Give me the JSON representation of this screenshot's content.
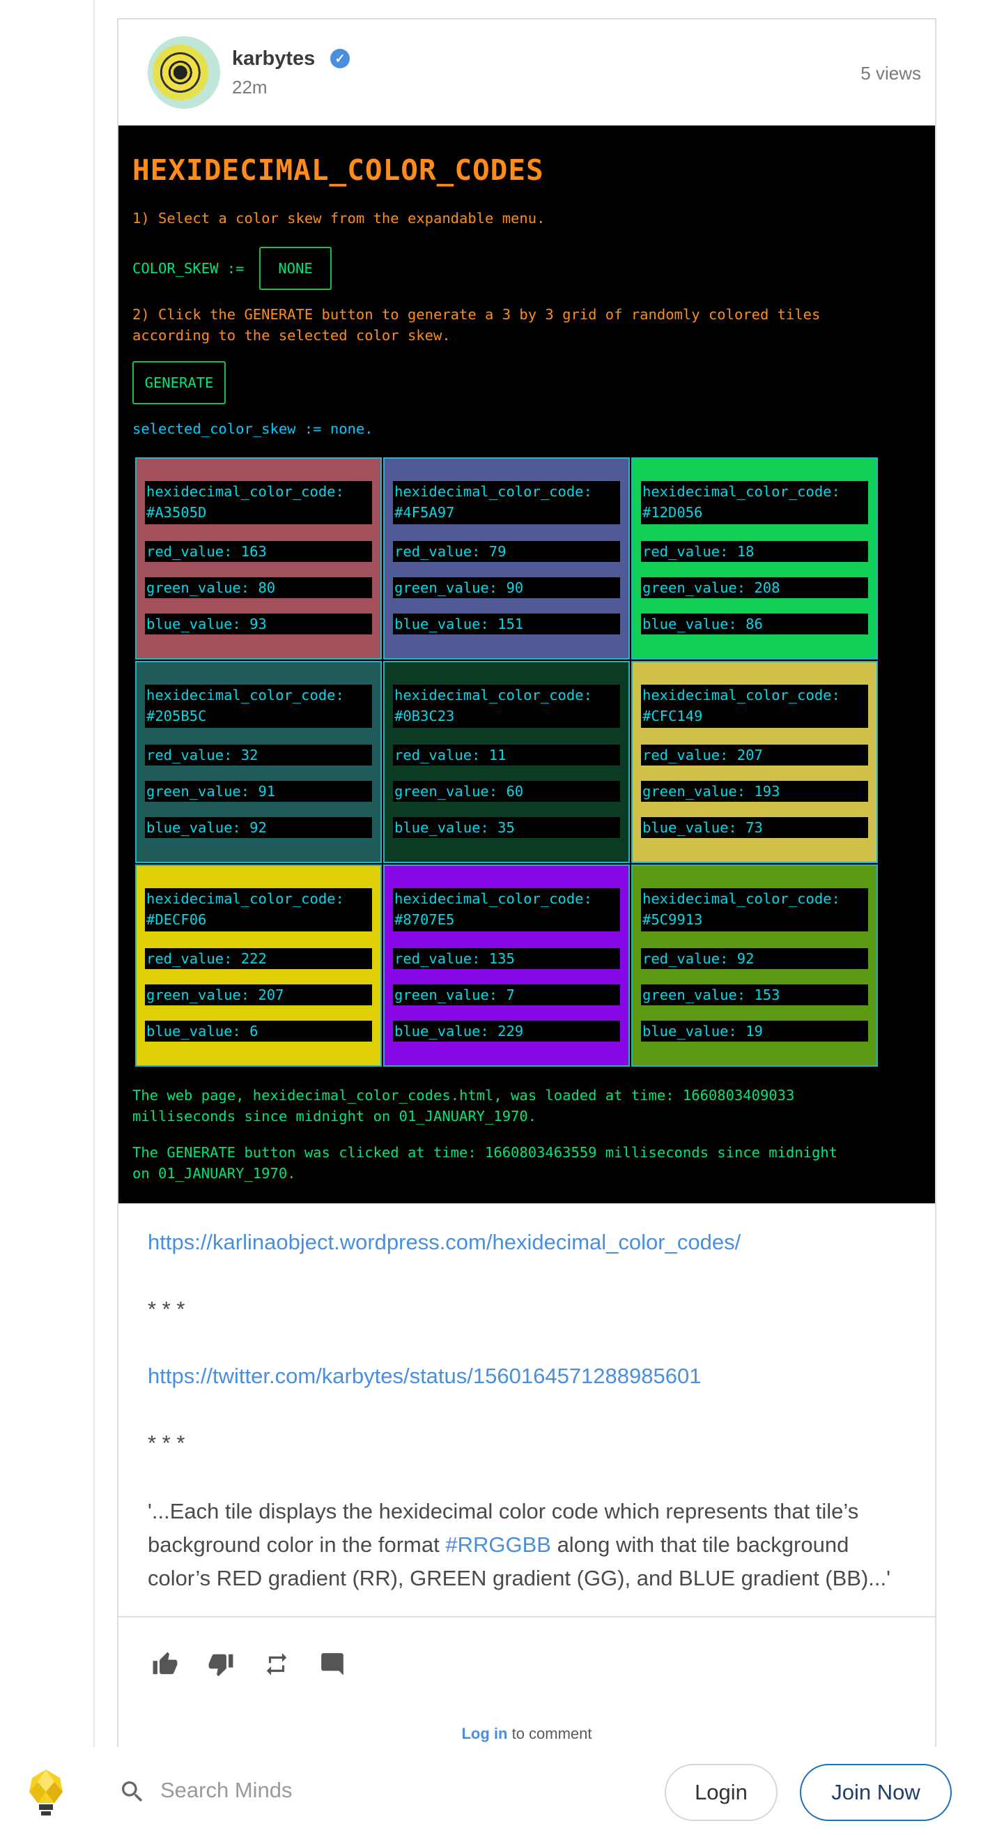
{
  "post": {
    "username": "karbytes",
    "verified_glyph": "✓",
    "time_ago": "22m",
    "views": "5 views"
  },
  "app": {
    "title": "HEXIDECIMAL_COLOR_CODES",
    "step1": "1) Select a color skew from the expandable menu.",
    "skew_label": "COLOR_SKEW :=",
    "skew_value": "NONE",
    "step2_line1": "2) Click the GENERATE button to generate a 3 by 3 grid of randomly colored tiles",
    "step2_line2": "according to the selected color skew.",
    "generate_label": "GENERATE",
    "selected_text": "selected_color_skew := none.",
    "tiles": [
      {
        "bg": "#A3505D",
        "code_label": "hexidecimal_color_code:",
        "code": "#A3505D",
        "red": "red_value: 163",
        "green": "green_value: 80",
        "blue": "blue_value: 93"
      },
      {
        "bg": "#4F5A97",
        "code_label": "hexidecimal_color_code:",
        "code": "#4F5A97",
        "red": "red_value: 79",
        "green": "green_value: 90",
        "blue": "blue_value: 151"
      },
      {
        "bg": "#12D056",
        "code_label": "hexidecimal_color_code:",
        "code": "#12D056",
        "red": "red_value: 18",
        "green": "green_value: 208",
        "blue": "blue_value: 86"
      },
      {
        "bg": "#205B5C",
        "code_label": "hexidecimal_color_code:",
        "code": "#205B5C",
        "red": "red_value: 32",
        "green": "green_value: 91",
        "blue": "blue_value: 92"
      },
      {
        "bg": "#0B3C23",
        "code_label": "hexidecimal_color_code:",
        "code": "#0B3C23",
        "red": "red_value: 11",
        "green": "green_value: 60",
        "blue": "blue_value: 35"
      },
      {
        "bg": "#CFC149",
        "code_label": "hexidecimal_color_code:",
        "code": "#CFC149",
        "red": "red_value: 207",
        "green": "green_value: 193",
        "blue": "blue_value: 73"
      },
      {
        "bg": "#DECF06",
        "code_label": "hexidecimal_color_code:",
        "code": "#DECF06",
        "red": "red_value: 222",
        "green": "green_value: 207",
        "blue": "blue_value: 6"
      },
      {
        "bg": "#8707E5",
        "code_label": "hexidecimal_color_code:",
        "code": "#8707E5",
        "red": "red_value: 135",
        "green": "green_value: 7",
        "blue": "blue_value: 229"
      },
      {
        "bg": "#5C9913",
        "code_label": "hexidecimal_color_code:",
        "code": "#5C9913",
        "red": "red_value: 92",
        "green": "green_value: 153",
        "blue": "blue_value: 19"
      }
    ],
    "loaded_line1": "The web page, hexidecimal_color_codes.html, was loaded at time: 1660803409033",
    "loaded_line2": "milliseconds since midnight on 01_JANUARY_1970.",
    "clicked_line1": "The GENERATE button was clicked at time: 1660803463559 milliseconds since midnight",
    "clicked_line2": "on 01_JANUARY_1970."
  },
  "body": {
    "link1": "https://karlinaobject.wordpress.com/hexidecimal_color_codes/",
    "sep1": "* * *",
    "link2": "https://twitter.com/karbytes/status/1560164571288985601",
    "sep2": "* * *",
    "quote_part1": "'...Each tile displays the hexidecimal color code which represents that tile’s background color in the format ",
    "quote_hashtag": "#RRGGBB",
    "quote_part2": " along with that tile background color’s RED gradient (RR), GREEN gradient (GG), and BLUE gradient (BB)...'"
  },
  "actions": {
    "thumbs_up_icon": "thumb-up",
    "thumbs_down_icon": "thumb-down",
    "remind_icon": "repeat",
    "comment_icon": "comment"
  },
  "comment": {
    "login_link": "Log in",
    "suffix": " to comment"
  },
  "bottom": {
    "search_placeholder": "Search Minds",
    "login_label": "Login",
    "join_label": "Join Now"
  }
}
